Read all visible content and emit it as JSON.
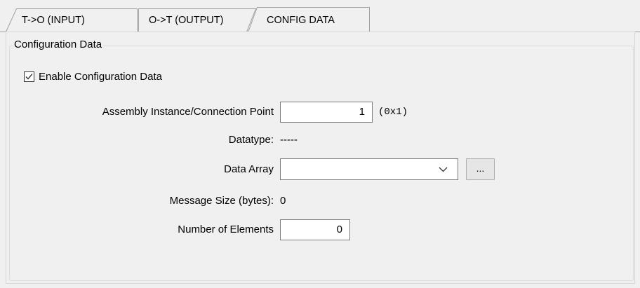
{
  "tabs": [
    {
      "label": "T->O (INPUT)",
      "selected": false
    },
    {
      "label": "O->T (OUTPUT)",
      "selected": false
    },
    {
      "label": "CONFIG DATA",
      "selected": true
    }
  ],
  "group": {
    "title": "Configuration Data"
  },
  "enable_config": {
    "label": "Enable Configuration Data",
    "checked": true
  },
  "fields": {
    "assembly_instance": {
      "label": "Assembly Instance/Connection Point",
      "value": "1",
      "hex": "(0x1)"
    },
    "datatype": {
      "label": "Datatype:",
      "value": "-----"
    },
    "data_array": {
      "label": "Data Array",
      "value": "",
      "button_label": "..."
    },
    "message_size": {
      "label": "Message Size (bytes):",
      "value": "0"
    },
    "number_of_elements": {
      "label": "Number of Elements",
      "value": "0"
    }
  },
  "colors": {
    "background": "#f0f0f0",
    "tab_border": "#a0a0a0",
    "input_border": "#7a7a7a",
    "button_face": "#e6e6e6"
  },
  "icons": {
    "checkmark": "checkmark-icon",
    "dropdown": "chevron-down-icon"
  }
}
